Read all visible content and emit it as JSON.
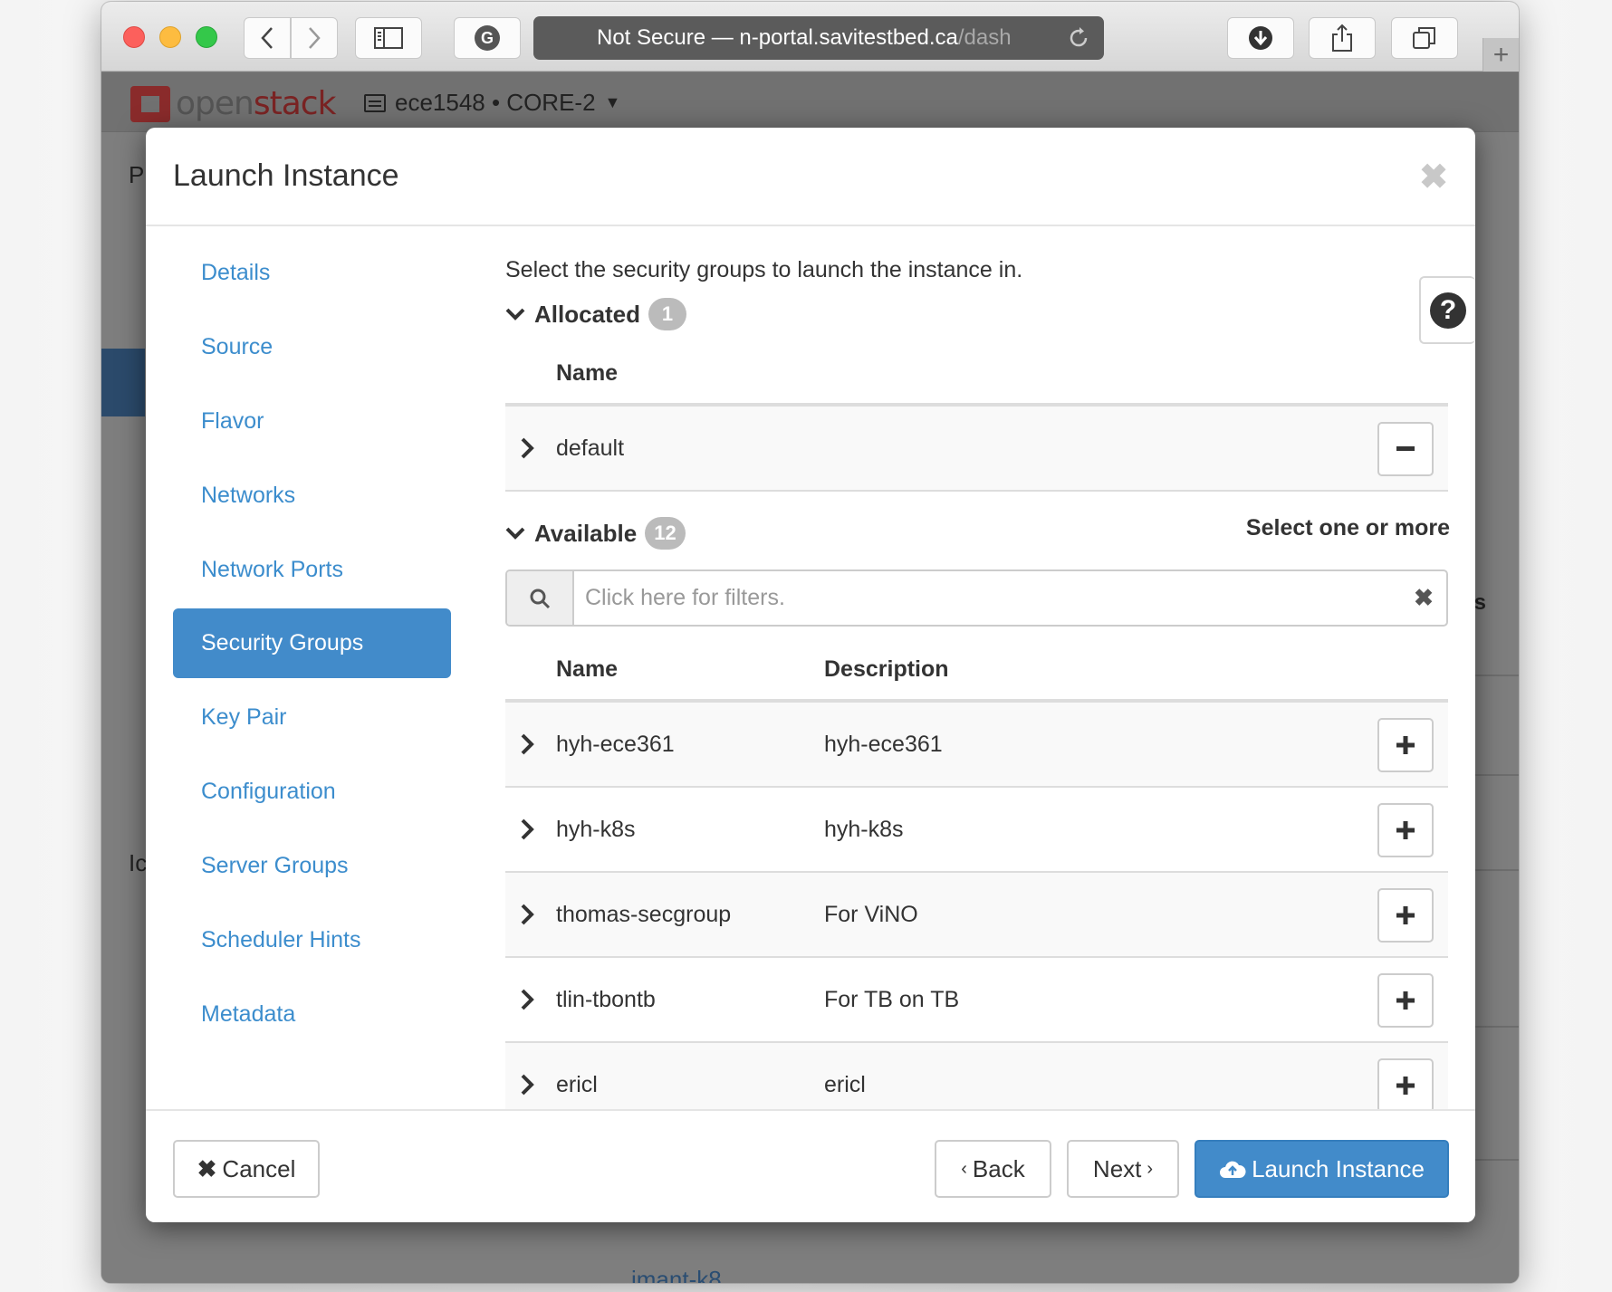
{
  "browser": {
    "address_secure_label": "Not Secure —",
    "address_host": "n-portal.savitestbed.ca",
    "address_path": "/dash",
    "new_tab": "+"
  },
  "app": {
    "logo_prefix": "open",
    "logo_suffix": "stack",
    "project_selector": "ece1548 • CORE-2",
    "background_page_letters": [
      "P",
      "Ic"
    ],
    "background_link": "imant-k8",
    "background_partial_text": "s"
  },
  "modal": {
    "title": "Launch Instance",
    "close_icon": "close-icon",
    "wizard_steps": [
      {
        "label": "Details",
        "active": false
      },
      {
        "label": "Source",
        "active": false
      },
      {
        "label": "Flavor",
        "active": false
      },
      {
        "label": "Networks",
        "active": false
      },
      {
        "label": "Network Ports",
        "active": false
      },
      {
        "label": "Security Groups",
        "active": true
      },
      {
        "label": "Key Pair",
        "active": false
      },
      {
        "label": "Configuration",
        "active": false
      },
      {
        "label": "Server Groups",
        "active": false
      },
      {
        "label": "Scheduler Hints",
        "active": false
      },
      {
        "label": "Metadata",
        "active": false
      }
    ],
    "help_icon": "?",
    "intro": "Select the security groups to launch the instance in.",
    "allocated": {
      "label": "Allocated",
      "count": "1",
      "columns": [
        "Name"
      ],
      "rows": [
        {
          "name": "default"
        }
      ]
    },
    "available": {
      "label": "Available",
      "count": "12",
      "hint": "Select one or more",
      "filter_placeholder": "Click here for filters.",
      "filter_value": "",
      "columns": [
        "Name",
        "Description"
      ],
      "rows": [
        {
          "name": "hyh-ece361",
          "description": "hyh-ece361"
        },
        {
          "name": "hyh-k8s",
          "description": "hyh-k8s"
        },
        {
          "name": "thomas-secgroup",
          "description": "For ViNO"
        },
        {
          "name": "tlin-tbontb",
          "description": "For TB on TB"
        },
        {
          "name": "ericl",
          "description": "ericl"
        }
      ]
    },
    "footer": {
      "cancel": "Cancel",
      "back": "Back",
      "next": "Next",
      "launch": "Launch Instance"
    }
  },
  "colors": {
    "accent": "#428bca",
    "link": "#3c8dcd",
    "badge": "#bbbbbb"
  }
}
